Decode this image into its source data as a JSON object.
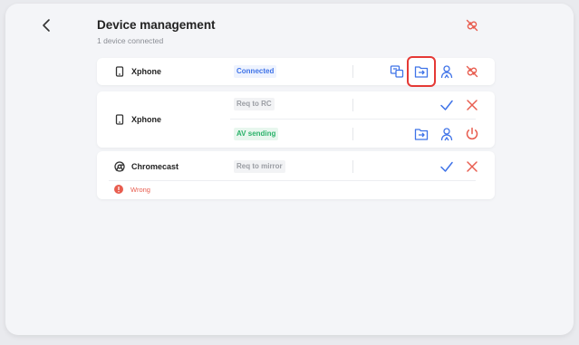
{
  "header": {
    "title": "Device management",
    "subtitle": "1 device connected"
  },
  "devices": [
    {
      "name": "Xphone",
      "status": "Connected"
    },
    {
      "name": "Xphone",
      "status_1": "Req to RC",
      "status_2": "AV sending"
    },
    {
      "name": "Chromecast",
      "status": "Req to mirror",
      "warning": "Wrong"
    }
  ],
  "colors": {
    "accent_blue": "#3f73e8",
    "danger_red": "#e85d4f",
    "success_green": "#2db36b",
    "highlight_red": "#e53935"
  },
  "icons": {
    "back": "chevron-left-icon",
    "disconnect": "unlink-icon",
    "phone": "phone-icon",
    "chromecast": "chromecast-icon",
    "screen_share": "screen-share-icon",
    "folder_transfer": "folder-transfer-icon",
    "user_control": "user-icon",
    "accept": "check-icon",
    "reject": "close-icon",
    "power": "power-icon",
    "warning": "warning-icon"
  }
}
